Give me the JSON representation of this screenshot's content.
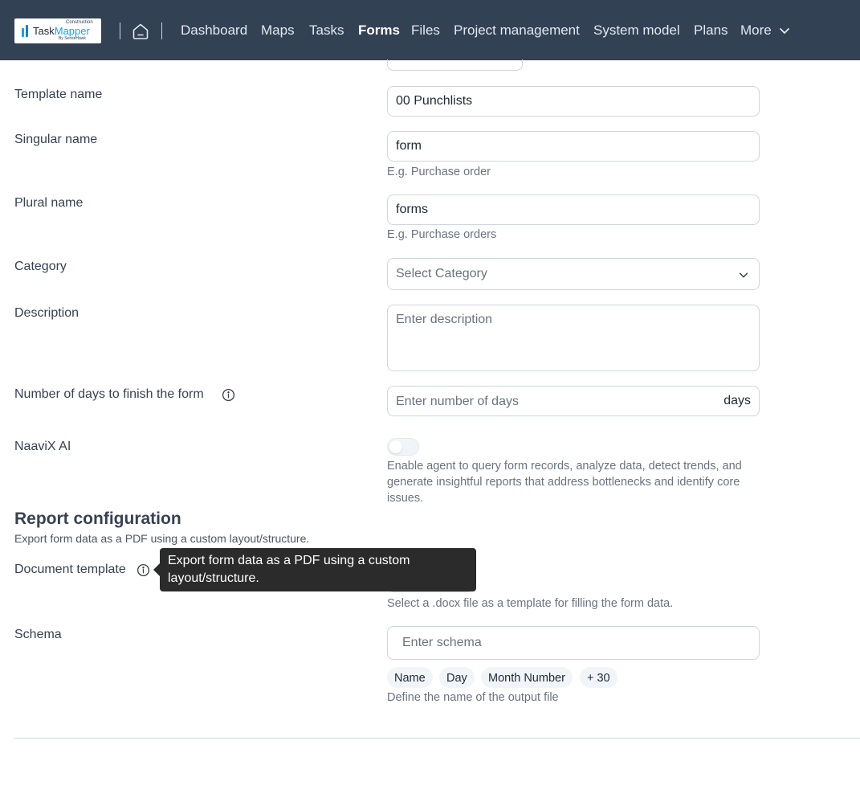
{
  "header": {
    "logo": {
      "top_text": "Construction",
      "main_text_a": "Task",
      "main_text_b": "Mapper",
      "by_text": "By SenseHawk"
    },
    "nav_items": [
      "Dashboard",
      "Maps",
      "Tasks",
      "Forms",
      "Files",
      "Project management",
      "System model",
      "Plans",
      "More"
    ],
    "active_item": "Forms"
  },
  "form": {
    "template_name": {
      "label": "Template name",
      "value": "00 Punchlists"
    },
    "singular_name": {
      "label": "Singular name",
      "value": "form",
      "help": "E.g. Purchase order"
    },
    "plural_name": {
      "label": "Plural name",
      "value": "forms",
      "help": "E.g. Purchase orders"
    },
    "category": {
      "label": "Category",
      "placeholder": "Select Category"
    },
    "description": {
      "label": "Description",
      "placeholder": "Enter description"
    },
    "days": {
      "label": "Number of days to finish the form",
      "placeholder": "Enter number of days",
      "suffix": "days"
    },
    "naavix": {
      "label": "NaaviX AI",
      "enabled": false,
      "help": "Enable agent to query form records, analyze data, detect trends, and generate insightful reports that address bottlenecks and identify core issues."
    }
  },
  "report": {
    "title": "Report configuration",
    "subtitle": "Export form data as a PDF using a custom layout/structure.",
    "document_template": {
      "label": "Document template",
      "help": "Select a .docx file as a template for filling the form data."
    },
    "tooltip": "Export form data as a PDF using a custom layout/structure.",
    "schema": {
      "label": "Schema",
      "placeholder": "Enter schema",
      "chips": [
        "Name",
        "Day",
        "Month Number"
      ],
      "more_chip": "+ 30",
      "help": "Define the name of the output file"
    }
  },
  "colors": {
    "header_bg": "#334155",
    "tooltip_bg": "#2b2b2b",
    "border": "#d1d5db",
    "accent": "#0ea5e9"
  }
}
